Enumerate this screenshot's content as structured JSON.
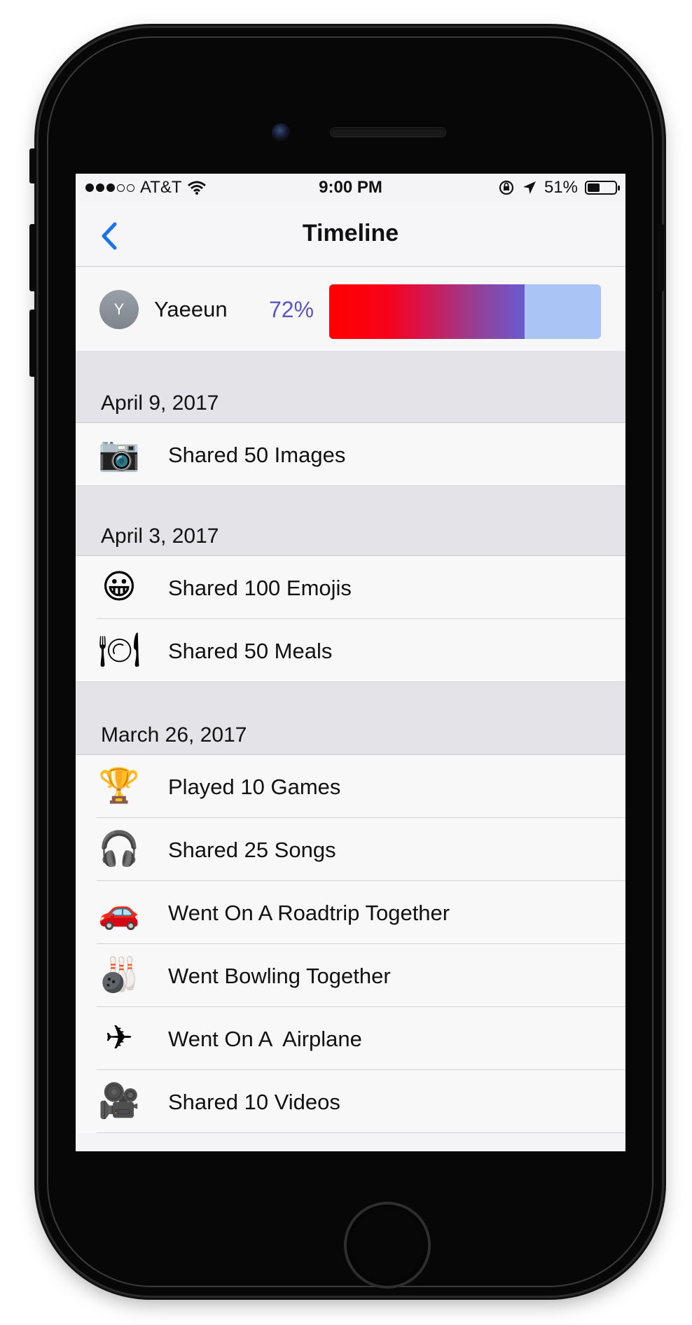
{
  "status_bar": {
    "carrier": "AT&T",
    "time": "9:00 PM",
    "battery_pct": "51%",
    "battery_level": 0.51,
    "signal_bars_filled": 3,
    "signal_bars_total": 5
  },
  "nav": {
    "title": "Timeline",
    "back_icon": "chevron-left-icon"
  },
  "profile": {
    "initial": "Y",
    "name": "Yaeeun",
    "percent_label": "72%",
    "percent_value": 0.72
  },
  "sections": [
    {
      "date": "April 9, 2017",
      "items": [
        {
          "icon": "📷",
          "icon_name": "camera-icon",
          "label": "Shared 50 Images"
        }
      ]
    },
    {
      "date": "April 3, 2017",
      "items": [
        {
          "icon": "😀",
          "icon_name": "grinning-face-icon",
          "label": "Shared 100 Emojis"
        },
        {
          "icon": "🍽",
          "icon_name": "plate-cutlery-icon",
          "label": "Shared 50 Meals"
        }
      ]
    },
    {
      "date": "March 26, 2017",
      "items": [
        {
          "icon": "🏆",
          "icon_name": "trophy-icon",
          "label": "Played 10 Games"
        },
        {
          "icon": "🎧",
          "icon_name": "headphones-icon",
          "label": "Shared 25 Songs"
        },
        {
          "icon": "🚗",
          "icon_name": "car-icon",
          "label": "Went On A Roadtrip Together"
        },
        {
          "icon": "🎳",
          "icon_name": "bowling-icon",
          "label": "Went Bowling Together"
        },
        {
          "icon": "✈",
          "icon_name": "airplane-icon",
          "label": "Went On A  Airplane"
        },
        {
          "icon": "🎥",
          "icon_name": "movie-camera-icon",
          "label": "Shared 10 Videos"
        }
      ]
    }
  ],
  "colors": {
    "accent": "#1a73e8",
    "percent_text": "#5b55c8",
    "bar_track": "#a9c4f5"
  }
}
